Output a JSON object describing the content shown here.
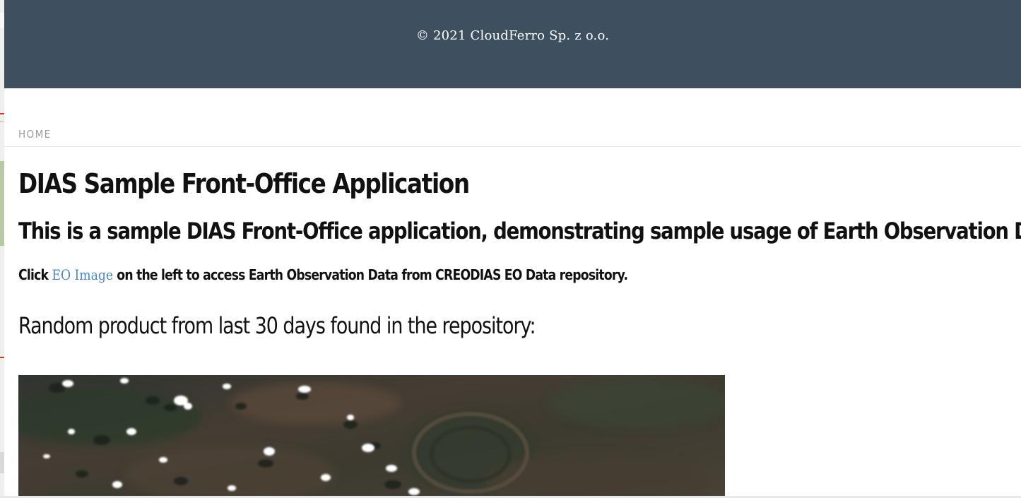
{
  "footer": {
    "copyright": "© 2021 CloudFerro Sp. z o.o."
  },
  "breadcrumb": {
    "home": "HOME"
  },
  "main": {
    "title": "DIAS Sample Front-Office Application",
    "subtitle": "This is a sample DIAS Front-Office application, demonstrating sample usage of Earth Observation Data.",
    "lead_prefix": "Click ",
    "lead_link": "EO Image",
    "lead_suffix": " on the left to access Earth Observation Data from CREODIAS EO Data repository.",
    "random_product_heading": "Random product from last 30 days found in the repository:"
  },
  "colors": {
    "footer_background": "#3e5060",
    "link": "#4a86c2",
    "breadcrumb": "#9b9b9b"
  }
}
